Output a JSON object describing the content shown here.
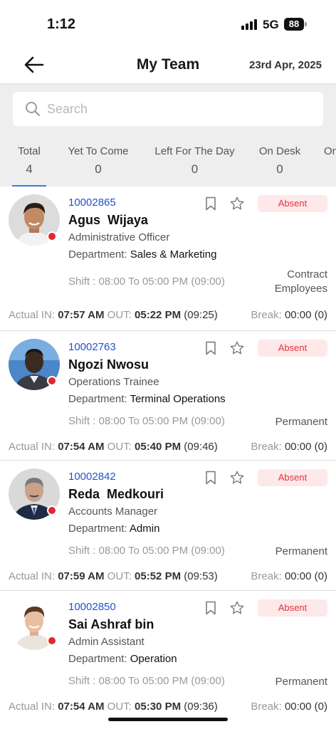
{
  "status_bar": {
    "time": "1:12",
    "network": "5G",
    "battery": "88"
  },
  "header": {
    "title": "My Team",
    "date": "23rd Apr, 2025"
  },
  "search": {
    "placeholder": "Search"
  },
  "stats": [
    {
      "label": "Total",
      "count": "4"
    },
    {
      "label": "Yet To Come",
      "count": "0"
    },
    {
      "label": "Left For The Day",
      "count": "0"
    },
    {
      "label": "On Desk",
      "count": "0"
    },
    {
      "label": "On",
      "count": ""
    }
  ],
  "labels": {
    "department": "Department: ",
    "actual_in": "Actual IN: ",
    "out": " OUT: ",
    "break": "Break: "
  },
  "employees": [
    {
      "id": "10002865",
      "name": "Agus  Wijaya",
      "role": "Administrative Officer",
      "department": "Sales & Marketing",
      "status": "Absent",
      "shift": "Shift : 08:00 To 05:00 PM (09:00)",
      "type": "Contract Employees",
      "actual_in": "07:57 AM",
      "actual_out": "05:22 PM",
      "worked": " (09:25)",
      "break": "00:00 (0)"
    },
    {
      "id": "10002763",
      "name": "Ngozi Nwosu",
      "role": "Operations Trainee",
      "department": "Terminal Operations",
      "status": "Absent",
      "shift": "Shift : 08:00 To 05:00 PM (09:00)",
      "type": "Permanent",
      "actual_in": "07:54 AM",
      "actual_out": "05:40 PM",
      "worked": " (09:46)",
      "break": "00:00 (0)"
    },
    {
      "id": "10002842",
      "name": "Reda  Medkouri",
      "role": "Accounts Manager",
      "department": "Admin",
      "status": "Absent",
      "shift": "Shift : 08:00 To 05:00 PM (09:00)",
      "type": "Permanent",
      "actual_in": "07:59 AM",
      "actual_out": "05:52 PM",
      "worked": " (09:53)",
      "break": "00:00 (0)"
    },
    {
      "id": "10002850",
      "name": "Sai Ashraf bin",
      "role": "Admin Assistant",
      "department": "Operation",
      "status": "Absent",
      "shift": "Shift : 08:00 To 05:00 PM (09:00)",
      "type": "Permanent",
      "actual_in": "07:54 AM",
      "actual_out": "05:30 PM",
      "worked": " (09:36)",
      "break": "00:00 (0)"
    }
  ],
  "colors": {
    "accent": "#3a7be0",
    "id_blue": "#2451c9",
    "absent_bg": "#fde8ea",
    "absent_text": "#e0363e",
    "status_red": "#e5262e"
  }
}
